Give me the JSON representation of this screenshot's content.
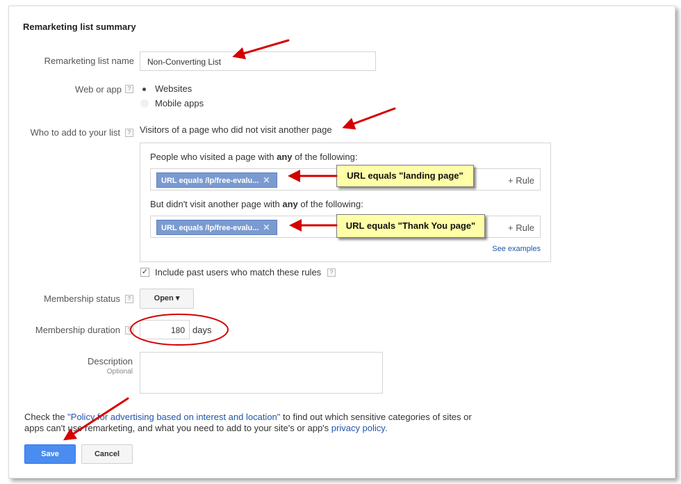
{
  "title": "Remarketing list summary",
  "fields": {
    "name": {
      "label": "Remarketing list name",
      "value": "Non-Converting List"
    },
    "web_or_app": {
      "label": "Web or app",
      "help": "?",
      "options": [
        "Websites",
        "Mobile apps"
      ],
      "selected": "Websites"
    },
    "who": {
      "label": "Who to add to your list",
      "help": "?",
      "value": "Visitors of a page who did not visit another page",
      "visited_prefix": "People who visited a page with ",
      "visited_bold": "any",
      "visited_suffix": " of the following:",
      "visited_chip": "URL equals /lp/free-evalu...",
      "not_visited_prefix": "But didn't visit another page with ",
      "not_visited_bold": "any",
      "not_visited_suffix": " of the following:",
      "not_visited_chip": "URL equals /lp/free-evalu...",
      "add_rule": "+ Rule",
      "chip_close": "✕",
      "see_examples": "See examples",
      "include_past": "Include past users who match these rules"
    },
    "membership_status": {
      "label": "Membership status",
      "help": "?",
      "value": "Open",
      "caret": "▾"
    },
    "membership_duration": {
      "label": "Membership duration",
      "help": "?",
      "value": "180",
      "unit": "days"
    },
    "description": {
      "label": "Description",
      "sublabel": "Optional",
      "value": ""
    }
  },
  "callouts": {
    "landing": "URL equals \"landing page\"",
    "thankyou": "URL equals \"Thank You page\""
  },
  "policy": {
    "pre": "Check the ",
    "link": "\"Policy for advertising based on interest and location\"",
    "mid": " to find out which sensitive categories of sites or",
    "line2": "apps can't use remarketing, and what you need to add to your site's or app's ",
    "link2": "privacy policy",
    "end": "."
  },
  "buttons": {
    "save": "Save",
    "cancel": "Cancel"
  },
  "colors": {
    "arrow": "#d40000",
    "callout_bg": "#ffffa8",
    "primary": "#4a8cf0",
    "link": "#2255aa",
    "chip": "#7b9bd0"
  }
}
